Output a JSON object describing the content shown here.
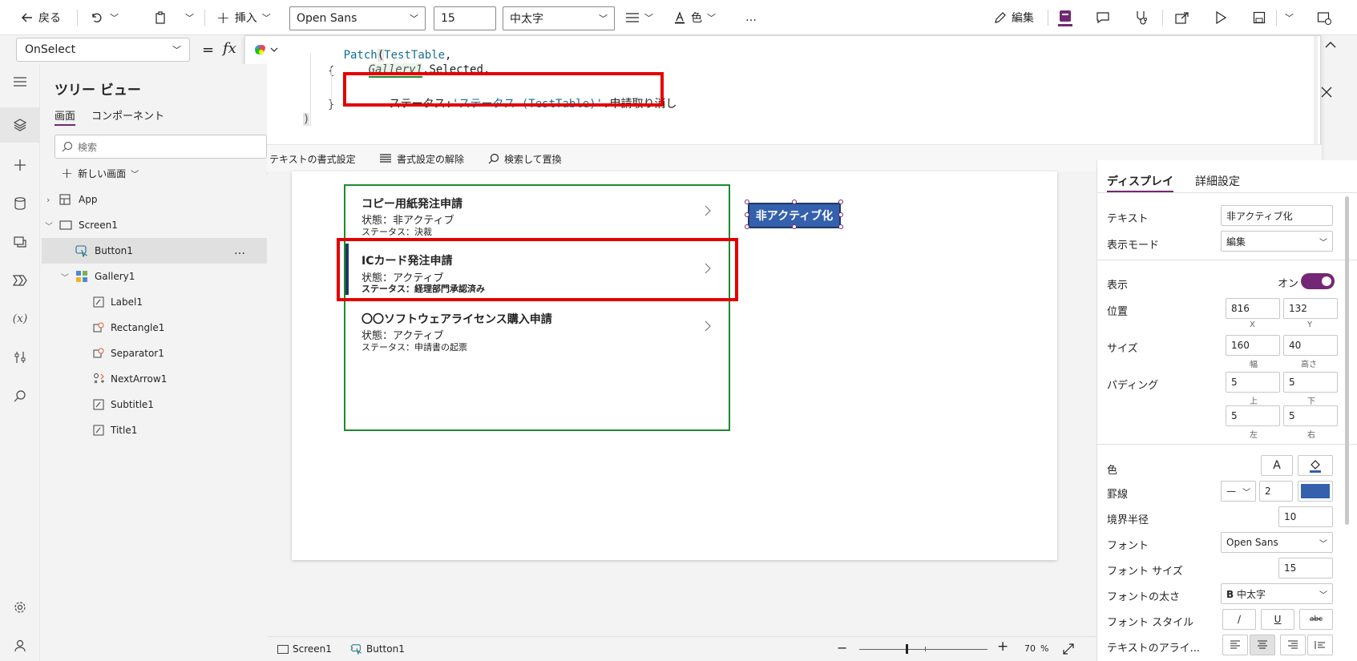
{
  "toolbar": {
    "back_label": "戻る",
    "insert_label": "挿入",
    "font_value": "Open Sans",
    "size_value": "15",
    "weight_value": "中太字",
    "color_label": "色",
    "more_label": "…",
    "edit_label": "編集"
  },
  "formula": {
    "property": "OnSelect",
    "equals": "=",
    "fx": "fx",
    "lines": {
      "l1_func": "Patch",
      "l1_paren": "(",
      "l1_table": "TestTable",
      "l1_comma": ",",
      "l2_gallery": "Gallery1",
      "l2_rest": ".Selected,",
      "l3": "{",
      "l4_key": "ステータス:",
      "l4_ref": "'ステータス (TestTable)'",
      "l4_rest": ".申請取り消し",
      "l5": "}",
      "l6": ")"
    },
    "format_text": "テキストの書式設定",
    "remove_format": "書式設定の解除",
    "find_replace": "検索して置換"
  },
  "tree": {
    "title": "ツリー ビュー",
    "tab_screens": "画面",
    "tab_components": "コンポーネント",
    "search_placeholder": "検索",
    "new_screen": "新しい画面",
    "items": {
      "app": "App",
      "screen1": "Screen1",
      "button1": "Button1",
      "button1_more": "…",
      "gallery1": "Gallery1",
      "label1": "Label1",
      "rectangle1": "Rectangle1",
      "separator1": "Separator1",
      "nextarrow1": "NextArrow1",
      "subtitle1": "Subtitle1",
      "title1": "Title1"
    }
  },
  "gallery": {
    "items": [
      {
        "title": "コピー用紙発注申請",
        "state": "状態：非アクティブ",
        "status": "ステータス：決裁"
      },
      {
        "title": "ICカード発注申請",
        "state": "状態：アクティブ",
        "status": "ステータス：経理部門承認済み"
      },
      {
        "title": "〇〇ソフトウェアライセンス購入申請",
        "state": "状態：アクティブ",
        "status": "ステータス：申請書の起票"
      }
    ]
  },
  "button_on_canvas": {
    "label": "非アクティブ化"
  },
  "props": {
    "tab_display": "ディスプレイ",
    "tab_advanced": "詳細設定",
    "text_label": "テキスト",
    "text_value": "非アクティブ化",
    "mode_label": "表示モード",
    "mode_value": "編集",
    "visible_label": "表示",
    "visible_value": "オン",
    "position_label": "位置",
    "x_value": "816",
    "y_value": "132",
    "x_sub": "X",
    "y_sub": "Y",
    "size_label": "サイズ",
    "w_value": "160",
    "h_value": "40",
    "w_sub": "幅",
    "h_sub": "高さ",
    "padding_label": "パディング",
    "pad_top": "5",
    "pad_bottom": "5",
    "pad_left": "5",
    "pad_right": "5",
    "pad_top_sub": "上",
    "pad_bottom_sub": "下",
    "pad_left_sub": "左",
    "pad_right_sub": "右",
    "color_label": "色",
    "color_a": "A",
    "border_label": "罫線",
    "border_style": "—",
    "border_width": "2",
    "radius_label": "境界半径",
    "radius_value": "10",
    "font_label": "フォント",
    "font_value": "Open Sans",
    "fontsize_label": "フォント サイズ",
    "fontsize_value": "15",
    "weight_label": "フォントの太さ",
    "weight_b": "B",
    "weight_value": "中太字",
    "style_label": "フォント スタイル",
    "style_italic": "/",
    "style_underline": "U",
    "style_strike": "abc",
    "align_label": "テキストのアライ..."
  },
  "status": {
    "screen": "Screen1",
    "button": "Button1",
    "zoom": "70",
    "zoom_unit": "%"
  },
  "colors": {
    "accent": "#742774",
    "button_fill": "#3460ad",
    "gallery_border": "#1e8a2e",
    "highlight": "#e50000"
  }
}
